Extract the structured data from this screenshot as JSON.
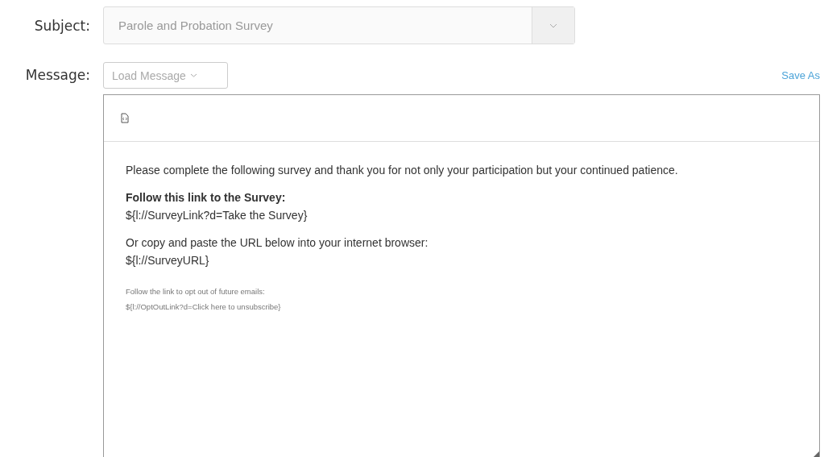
{
  "subject": {
    "label": "Subject:",
    "value": "Parole and Probation Survey",
    "disabled": true
  },
  "message": {
    "label": "Message:",
    "load_button": "Load Message",
    "save_as": "Save As"
  },
  "editor": {
    "paragraphs": [
      {
        "kind": "normal",
        "lines": [
          "Please complete the following survey and thank you for not only your participation but your continued patience."
        ]
      },
      {
        "kind": "normal",
        "lines": [
          {
            "text": "Follow this link to the Survey:",
            "bold": true
          },
          {
            "text": "${l://SurveyLink?d=Take the Survey}",
            "bold": false
          }
        ]
      },
      {
        "kind": "normal",
        "lines": [
          {
            "text": "Or copy and paste the URL below into your internet browser:",
            "bold": false
          },
          {
            "text": "${l://SurveyURL}",
            "bold": false
          }
        ]
      },
      {
        "kind": "small",
        "lines": [
          {
            "text": "Follow the link to opt out of future emails:",
            "bold": false
          },
          {
            "text": "${l://OptOutLink?d=Click here to unsubscribe}",
            "bold": false
          }
        ]
      }
    ]
  }
}
